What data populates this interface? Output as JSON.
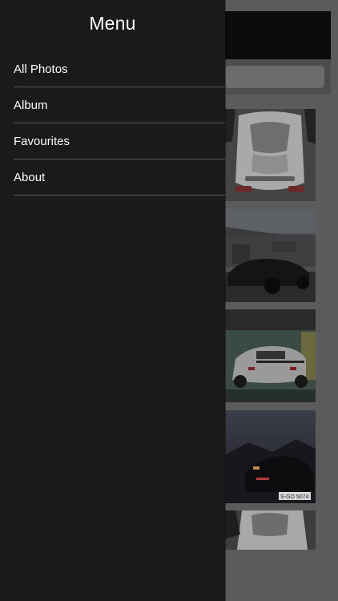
{
  "drawer": {
    "title": "Menu",
    "items": [
      {
        "label": "All Photos"
      },
      {
        "label": "Album"
      },
      {
        "label": "Favourites"
      },
      {
        "label": "About"
      }
    ]
  },
  "gallery": {
    "thumbnails": [
      {
        "subject": "white-car-top-view"
      },
      {
        "subject": "black-car-by-building"
      },
      {
        "subject": "white-car-in-garage"
      },
      {
        "subject": "dark-car-at-dusk",
        "plate_text": "S-GO 5074"
      },
      {
        "subject": "white-car-partial"
      }
    ]
  },
  "colors": {
    "drawer_bg": "#1a1a1a",
    "divider": "#5a5a5a",
    "overlay": "#5b5b5b",
    "text": "#ffffff"
  }
}
